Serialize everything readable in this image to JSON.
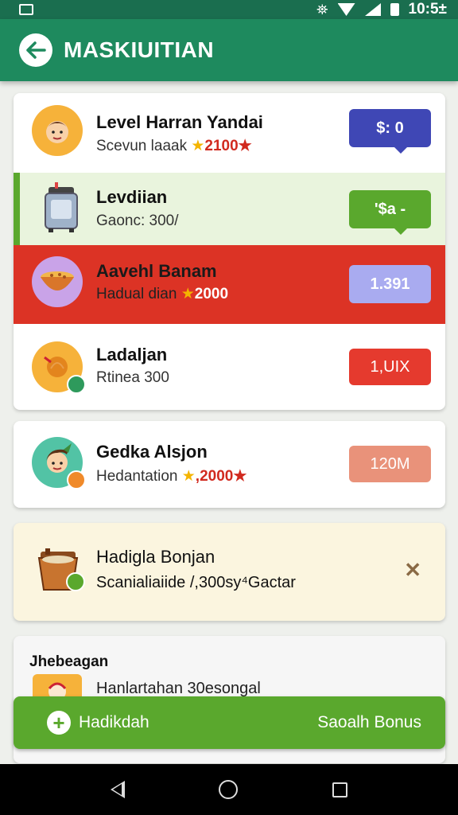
{
  "status_bar": {
    "time": "10:5⁠±"
  },
  "app_bar": {
    "title": "MASKIUITIAN"
  },
  "list": [
    {
      "title": "Level Harran Yandai",
      "sub_text": "Scevun laaak",
      "star": "★",
      "amount": "2100★",
      "pill": "$: 0",
      "pill_color": "#3f47b5"
    },
    {
      "title": "Levdiian",
      "sub_text": "Gaonc: 300/",
      "star": "",
      "amount": "",
      "pill": "'$a ‑",
      "pill_color": "#5aa82d"
    },
    {
      "title": "Aavehl Banam",
      "sub_text": "Hadual dian",
      "star": "★",
      "amount": "2000",
      "pill": "1.391",
      "pill_color": "#a9abf0"
    },
    {
      "title": "Ladaljan",
      "sub_text": "Rtinea 300",
      "star": "",
      "amount": "",
      "pill": "1,UIX",
      "pill_color": "#e53a2e"
    }
  ],
  "card2": {
    "title": "Gedka Alsjon",
    "sub_text": "Hedantation",
    "star": "★",
    "amount": ",2000★",
    "pill": "120M",
    "pill_color": "#e9927a"
  },
  "card3": {
    "title": "Hadigla Bonjan",
    "sub_text": "Scanialiaiide /,300sy⁴Gactar",
    "close": "✕"
  },
  "card4": {
    "heading": "Jhebeagan",
    "text": "Hanlartahan 30esongal"
  },
  "bottom_bar": {
    "left_label": "Hadikdah",
    "right_label": "Saoalh Bonus"
  },
  "colors": {
    "app_bar": "#1e8a5e",
    "status_bar": "#1a6e4f",
    "accent_green": "#5aa82d",
    "red_row": "#dc3325"
  }
}
